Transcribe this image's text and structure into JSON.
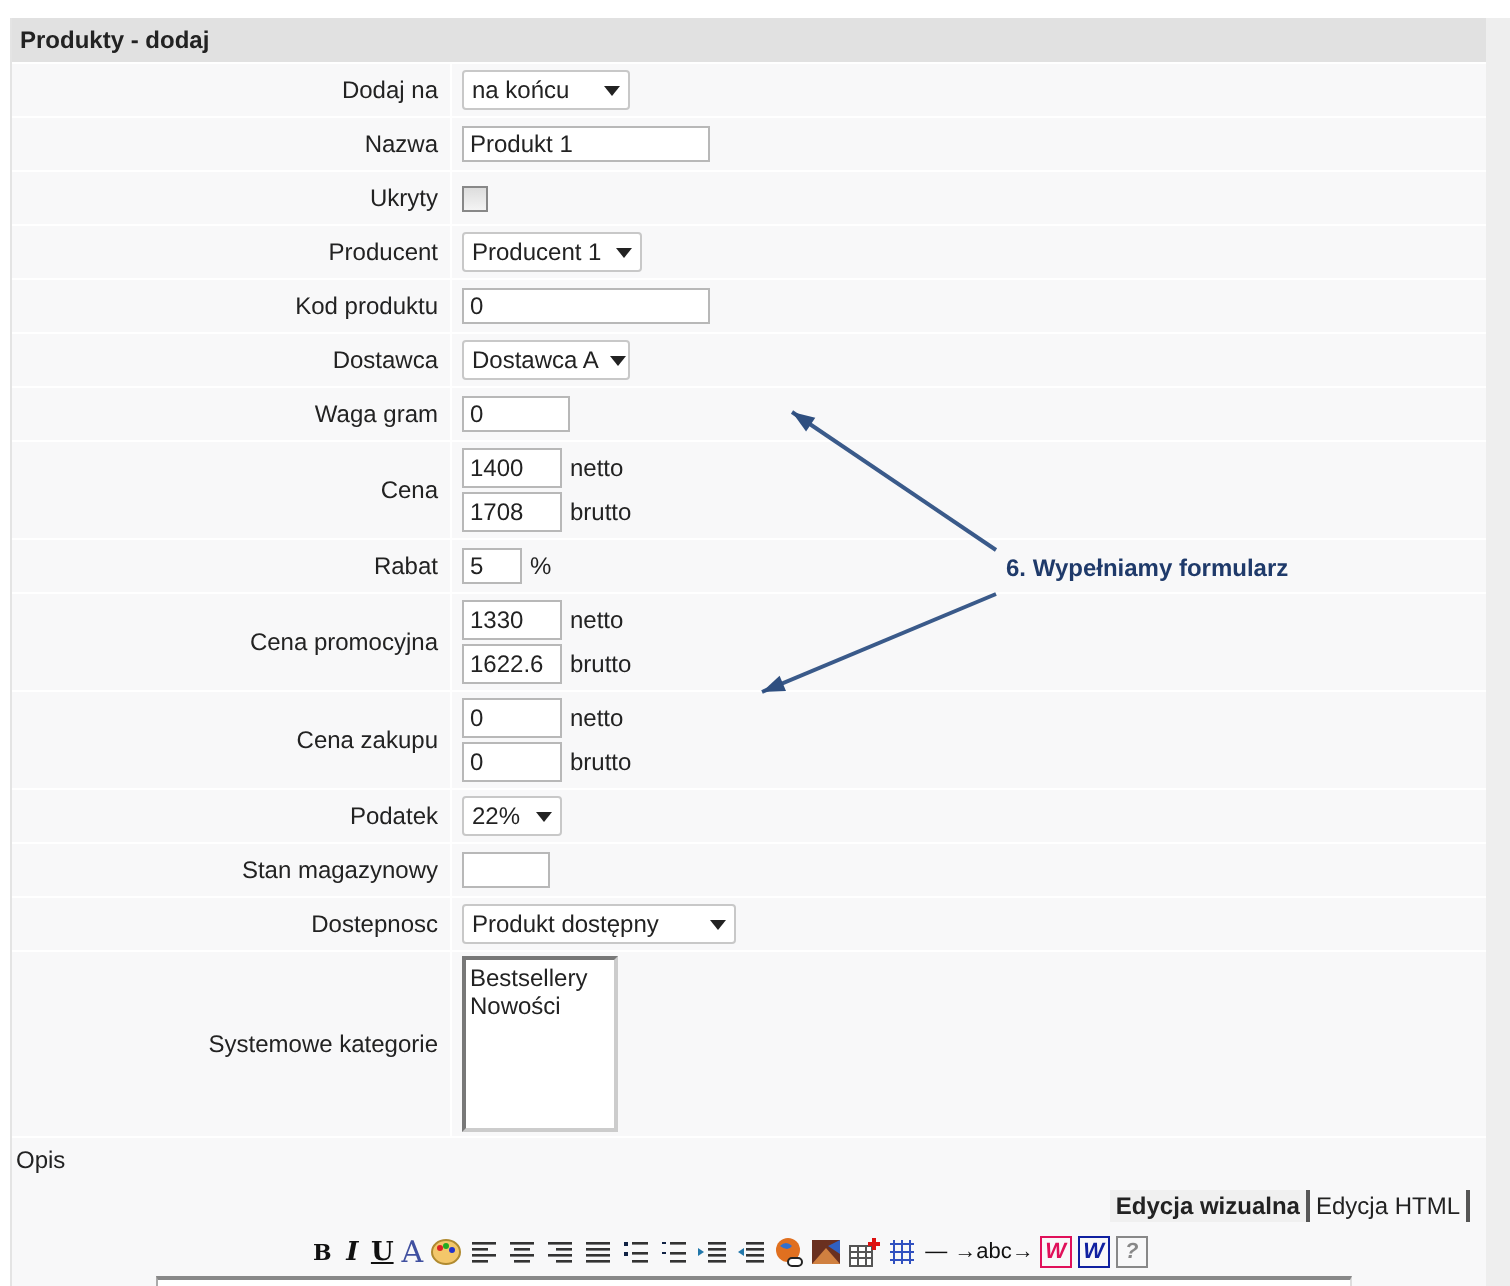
{
  "panel": {
    "title": "Produkty - dodaj"
  },
  "fields": [
    {
      "label": "Dodaj na",
      "kind": "select",
      "value": "na końcu"
    },
    {
      "label": "Nazwa",
      "kind": "text",
      "value": "Produkt 1"
    },
    {
      "label": "Ukryty",
      "kind": "checkbox",
      "checked": false
    },
    {
      "label": "Producent",
      "kind": "select",
      "value": "Producent 1"
    },
    {
      "label": "Kod produktu",
      "kind": "text",
      "value": "0"
    },
    {
      "label": "Dostawca",
      "kind": "select",
      "value": "Dostawca A"
    },
    {
      "label": "Waga gram",
      "kind": "text",
      "value": "0"
    },
    {
      "label": "Cena",
      "kind": "pair",
      "inputs": [
        {
          "value": "1400",
          "unit": "netto"
        },
        {
          "value": "1708",
          "unit": "brutto"
        }
      ]
    },
    {
      "label": "Rabat",
      "kind": "text",
      "value": "5",
      "unit": "%"
    },
    {
      "label": "Cena promocyjna",
      "kind": "pair",
      "inputs": [
        {
          "value": "1330",
          "unit": "netto"
        },
        {
          "value": "1622.6",
          "unit": "brutto"
        }
      ]
    },
    {
      "label": "Cena zakupu",
      "kind": "pair",
      "inputs": [
        {
          "value": "0",
          "unit": "netto"
        },
        {
          "value": "0",
          "unit": "brutto"
        }
      ]
    },
    {
      "label": "Podatek",
      "kind": "select",
      "value": "22%"
    },
    {
      "label": "Stan magazynowy",
      "kind": "text"
    },
    {
      "label": "Dostepnosc",
      "kind": "select",
      "value": "Produkt dostępny"
    },
    {
      "label": "Systemowe kategorie",
      "kind": "listbox",
      "options": [
        "Bestsellery",
        "Nowości"
      ]
    }
  ],
  "annotation": {
    "text": "6. Wypełniamy formularz"
  },
  "description": {
    "label": "Opis",
    "tabs": [
      {
        "label": "Edycja wizualna",
        "selected": true
      },
      {
        "label": "Edycja HTML",
        "selected": false
      }
    ],
    "toolbar": [
      {
        "kind": "glyph",
        "label": "B"
      },
      {
        "kind": "glyph",
        "label": "I"
      },
      {
        "kind": "glyph",
        "label": "U"
      },
      {
        "kind": "glyph",
        "label": "A"
      },
      {
        "kind": "palette"
      },
      {
        "kind": "align-left"
      },
      {
        "kind": "align-center"
      },
      {
        "kind": "align-right"
      },
      {
        "kind": "justify"
      },
      {
        "kind": "bullets"
      },
      {
        "kind": "numbers"
      },
      {
        "kind": "indent"
      },
      {
        "kind": "outdent"
      },
      {
        "kind": "globe"
      },
      {
        "kind": "image"
      },
      {
        "kind": "table"
      },
      {
        "kind": "grid"
      },
      {
        "kind": "glyph",
        "label": "—"
      },
      {
        "kind": "glyph",
        "label": "→abc→"
      },
      {
        "kind": "boxed",
        "label": "W",
        "color": "#e0105a"
      },
      {
        "kind": "boxed",
        "label": "W",
        "color": "#1020a0"
      },
      {
        "kind": "boxed",
        "label": "?",
        "color": "#888888"
      }
    ]
  }
}
